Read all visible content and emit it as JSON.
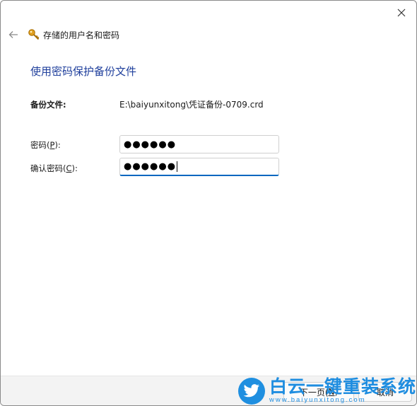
{
  "titlebar": {
    "title": "存储的用户名和密码"
  },
  "main": {
    "heading": "使用密码保护备份文件",
    "backup_file": {
      "label": "备份文件:",
      "value": "E:\\baiyunxitong\\凭证备份-0709.crd"
    },
    "password": {
      "label_before": "密码(",
      "mnemonic": "P",
      "label_after": "):",
      "value": "●●●●●●"
    },
    "confirm_password": {
      "label_before": "确认密码(",
      "mnemonic": "C",
      "label_after": "):",
      "value": "●●●●●●"
    }
  },
  "footer": {
    "next_label_before": "下一页(",
    "next_mnemonic": "N",
    "next_label_after": ")",
    "cancel_label": "取消"
  },
  "watermark": {
    "main_text": "白云一键重装系统",
    "sub_text": "www.baiyunxitong.com"
  },
  "colors": {
    "heading": "#1f3f9c",
    "focus_accent": "#0067c0",
    "watermark": "#1e8de0"
  },
  "icons": [
    "close-icon",
    "back-arrow-icon",
    "key-icon",
    "twitter-bird-icon"
  ]
}
